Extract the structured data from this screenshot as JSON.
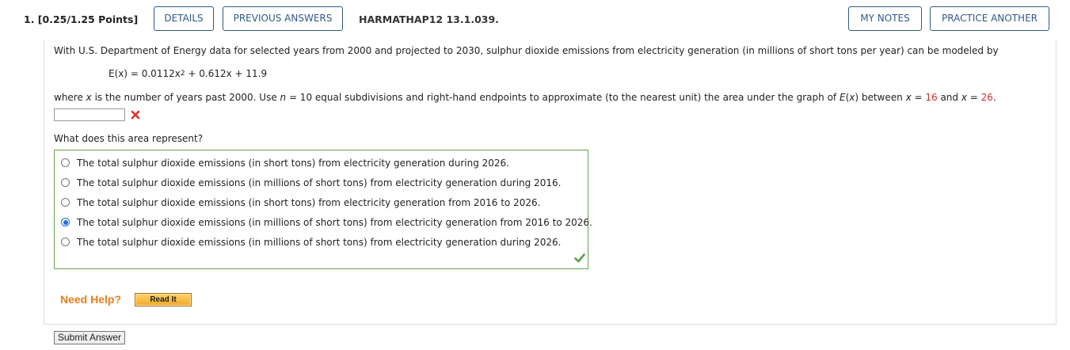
{
  "header": {
    "question_label": "1.  [0.25/1.25 Points]",
    "details_label": "DETAILS",
    "previous_answers_label": "PREVIOUS ANSWERS",
    "code": "HARMATHAP12 13.1.039.",
    "my_notes_label": "MY NOTES",
    "practice_another_label": "PRACTICE ANOTHER",
    "accent_color": "#2f5a86"
  },
  "problem": {
    "intro": "With U.S. Department of Energy data for selected years from 2000 and projected to 2030, sulphur dioxide emissions from electricity generation (in millions of short tons per year) can be modeled by",
    "formula_lhs": "E(x) = 0.0112x",
    "formula_exp": "2",
    "formula_rhs": " + 0.612x + 11.9",
    "instruction_a": "where ",
    "instruction_x": "x",
    "instruction_b": " is the number of years past 2000. Use ",
    "instruction_n": "n",
    "instruction_c": " = 10 equal subdivisions and right-hand endpoints to approximate (to the nearest unit) the area under the graph of ",
    "instruction_E": "E",
    "instruction_d": "(",
    "instruction_x2": "x",
    "instruction_e": ") between ",
    "instruction_x3": "x",
    "instruction_f": " = ",
    "lower_value": "16",
    "instruction_g": " and ",
    "instruction_x4": "x",
    "instruction_h": " = ",
    "upper_value": "26",
    "instruction_i": ".",
    "answer_value": "",
    "answer_status_icon": "x-mark-icon",
    "question2": "What does this area represent?"
  },
  "choices": {
    "options": [
      "The total sulphur dioxide emissions (in short tons) from electricity generation during 2026.",
      "The total sulphur dioxide emissions (in millions of short tons) from electricity generation during 2016.",
      "The total sulphur dioxide emissions (in short tons) from electricity generation from 2016 to 2026.",
      "The total sulphur dioxide emissions (in millions of short tons) from electricity generation from 2016 to 2026.",
      "The total sulphur dioxide emissions (in millions of short tons) from electricity generation during 2026."
    ],
    "selected_index": 3,
    "status_icon": "check-mark-icon",
    "border_color": "#68a34a"
  },
  "help": {
    "need_help_label": "Need Help?",
    "read_it_label": "Read It"
  },
  "submit_label": "Submit Answer"
}
